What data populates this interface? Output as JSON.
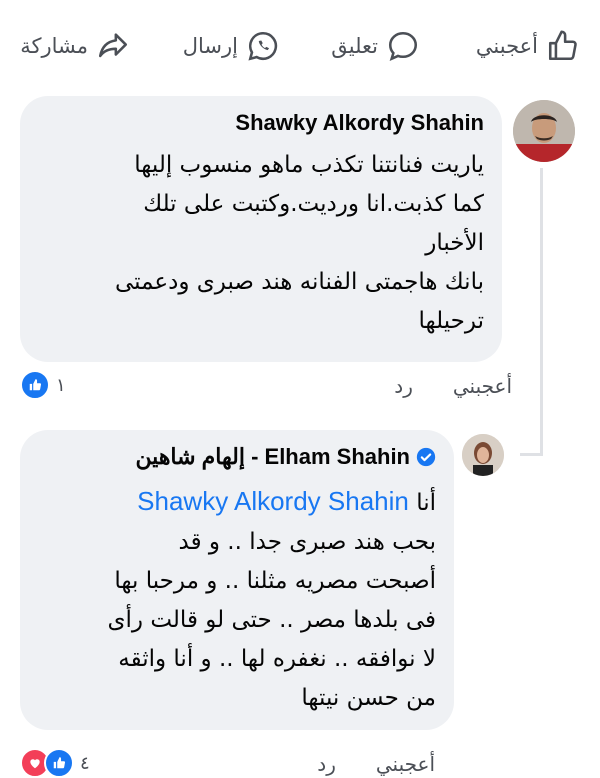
{
  "actions": {
    "like": "أعجبني",
    "comment": "تعليق",
    "send": "إرسال",
    "share": "مشاركة"
  },
  "comments": [
    {
      "author": "Shawky Alkordy Shahin",
      "text": "ياريت فنانتنا تكذب ماهو منسوب إليها\nكما كذبت.انا ورديت.وكتبت على تلك\nالأخبار\nبانك هاجمتى الفنانه هند صبرى ودعمتى\nترحيلها",
      "like_label": "أعجبني",
      "reply_label": "رد",
      "reaction_count": "١"
    },
    {
      "author": "إلهام شاهين - Elham Shahin",
      "mention": "Shawky Alkordy Shahin",
      "lead": "أنا",
      "text": "بحب هند صبرى جدا  .. و قد\nأصبحت مصريه مثلنا .. و مرحبا بها\nفى بلدها مصر .. حتى لو قالت رأى\nلا نوافقه .. نغفره لها .. و أنا واثقه\nمن حسن نيتها",
      "like_label": "أعجبني",
      "reply_label": "رد",
      "reaction_count": "٤"
    }
  ],
  "colors": {
    "bubble": "#eff1f4",
    "mention": "#1877f2",
    "like_blue": "#1877f2",
    "heart_red": "#f33e58"
  }
}
